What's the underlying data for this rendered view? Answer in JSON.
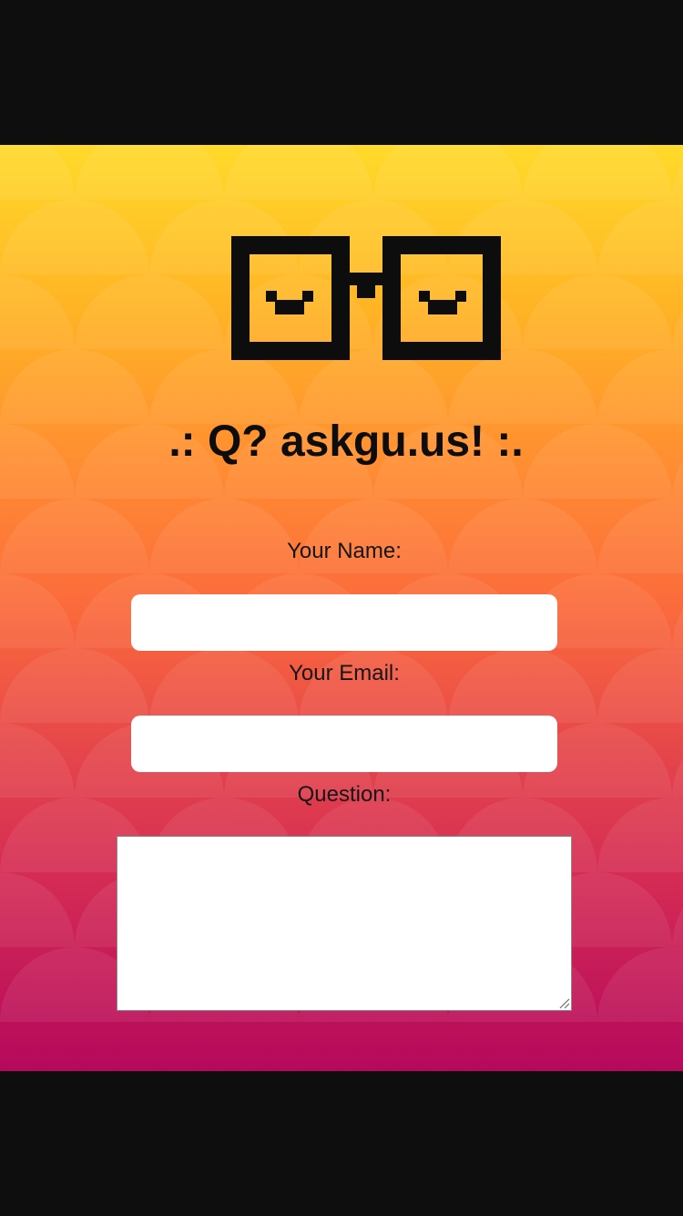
{
  "header": {
    "logo_icon": "nerd-glasses-icon",
    "title": ".: Q? askgu.us! :."
  },
  "form": {
    "name_label": "Your Name:",
    "name_value": "",
    "email_label": "Your Email:",
    "email_value": "",
    "question_label": "Question:",
    "question_value": ""
  },
  "colors": {
    "gradient_top": "#ffda2a",
    "gradient_bottom": "#b5095c",
    "frame": "#0e0e0e",
    "text": "#0d0d0d"
  }
}
